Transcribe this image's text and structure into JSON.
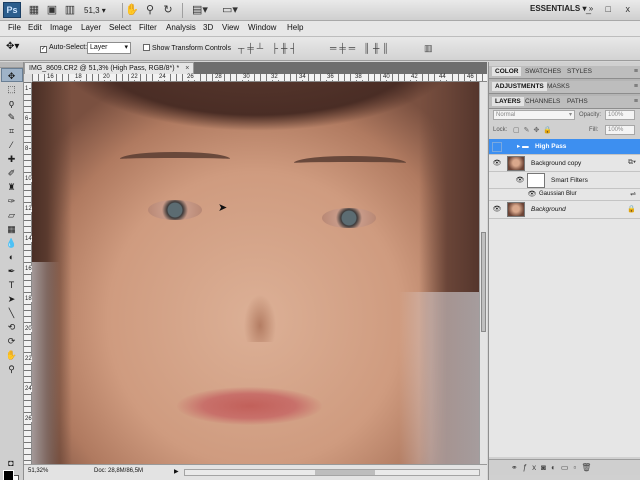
{
  "app_bar": {
    "logo": "Ps",
    "zoom": "51,3",
    "workspace": "ESSENTIALS",
    "window_controls": "_ □ x",
    "icons": [
      "bridge-icon",
      "mini-bridge-icon",
      "view-extras-icon",
      "hand-tool-icon",
      "zoom-tool-icon",
      "rotate-view-icon",
      "arrange-documents-icon",
      "screen-mode-icon"
    ]
  },
  "menu": [
    "File",
    "Edit",
    "Image",
    "Layer",
    "Select",
    "Filter",
    "Analysis",
    "3D",
    "View",
    "Window",
    "Help"
  ],
  "options_bar": {
    "auto_select_label": "Auto-Select:",
    "auto_select_checked": true,
    "auto_select_value": "Layer",
    "show_transform_label": "Show Transform Controls",
    "show_transform_checked": false
  },
  "tools": [
    "move",
    "marquee",
    "lasso",
    "quick-select",
    "crop",
    "eyedropper",
    "spot-heal",
    "brush",
    "clone-stamp",
    "history-brush",
    "eraser",
    "gradient",
    "blur",
    "dodge",
    "pen",
    "type",
    "path-select",
    "shape",
    "3d-rotate",
    "3d-orbit",
    "hand",
    "zoom"
  ],
  "document": {
    "tab_title": "IMG_8609.CR2 @ 51,3% (High Pass, RGB/8*) *",
    "close": "×",
    "ruler_h_ticks": [
      "16",
      "18",
      "20",
      "22",
      "24",
      "26",
      "28",
      "30",
      "32",
      "34",
      "36",
      "38",
      "40",
      "42",
      "44",
      "46"
    ],
    "ruler_v_ticks": [
      "1",
      "6",
      "8",
      "10",
      "12",
      "14",
      "16",
      "18",
      "20",
      "22",
      "24",
      "26"
    ],
    "status_zoom": "51,32%",
    "status_doc": "Doc: 28,8M/86,5M"
  },
  "panels": {
    "group1_tabs": [
      "COLOR",
      "SWATCHES",
      "STYLES"
    ],
    "group2_tabs": [
      "ADJUSTMENTS",
      "MASKS"
    ],
    "group3_tabs": [
      "LAYERS",
      "CHANNELS",
      "PATHS"
    ],
    "blend_mode": "Normal",
    "opacity_label": "Opacity:",
    "opacity_value": "100%",
    "lock_label": "Lock:",
    "fill_label": "Fill:",
    "fill_value": "100%",
    "layers": [
      {
        "name": "High Pass",
        "selected": true,
        "visible": false,
        "type": "group"
      },
      {
        "name": "Background copy",
        "selected": false,
        "visible": true,
        "type": "smart-object"
      },
      {
        "name": "Smart Filters",
        "selected": false,
        "visible": true,
        "type": "smart-filters"
      },
      {
        "name": "Gaussian Blur",
        "selected": false,
        "visible": true,
        "type": "filter"
      },
      {
        "name": "Background",
        "selected": false,
        "visible": true,
        "type": "image",
        "locked": true
      }
    ]
  }
}
